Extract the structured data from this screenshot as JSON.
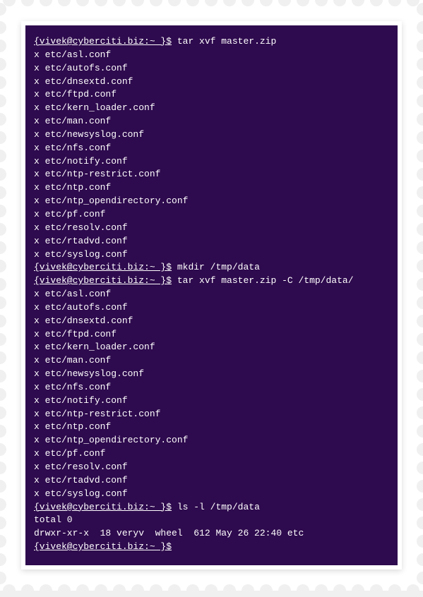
{
  "terminal": {
    "bg_color": "#2e0a4e",
    "fg_color": "#ffffff",
    "prompt_user": "{vivek@cyberciti.biz",
    "prompt_path": ":~ }$",
    "commands": [
      {
        "prompt": "{vivek@cyberciti.biz",
        "path": ":~ }$",
        "cmd": "tar xvf master.zip"
      },
      {
        "prompt": "{vivek@cyberciti.biz",
        "path": ":~ }$",
        "cmd": "mkdir /tmp/data"
      },
      {
        "prompt": "{vivek@cyberciti.biz",
        "path": ":~ }$",
        "cmd": "tar xvf master.zip -C /tmp/data/"
      },
      {
        "prompt": "{vivek@cyberciti.biz",
        "path": ":~ }$",
        "cmd": "ls -l /tmp/data"
      },
      {
        "prompt": "{vivek@cyberciti.biz",
        "path": ":~ }$",
        "cmd": ""
      }
    ],
    "extract_output_1": [
      "x etc/asl.conf",
      "x etc/autofs.conf",
      "x etc/dnsextd.conf",
      "x etc/ftpd.conf",
      "x etc/kern_loader.conf",
      "x etc/man.conf",
      "x etc/newsyslog.conf",
      "x etc/nfs.conf",
      "x etc/notify.conf",
      "x etc/ntp-restrict.conf",
      "x etc/ntp.conf",
      "x etc/ntp_opendirectory.conf",
      "x etc/pf.conf",
      "x etc/resolv.conf",
      "x etc/rtadvd.conf",
      "x etc/syslog.conf"
    ],
    "extract_output_2": [
      "x etc/asl.conf",
      "x etc/autofs.conf",
      "x etc/dnsextd.conf",
      "x etc/ftpd.conf",
      "x etc/kern_loader.conf",
      "x etc/man.conf",
      "x etc/newsyslog.conf",
      "x etc/nfs.conf",
      "x etc/notify.conf",
      "x etc/ntp-restrict.conf",
      "x etc/ntp.conf",
      "x etc/ntp_opendirectory.conf",
      "x etc/pf.conf",
      "x etc/resolv.conf",
      "x etc/rtadvd.conf",
      "x etc/syslog.conf"
    ],
    "ls_output": [
      "total 0",
      "drwxr-xr-x  18 veryv  wheel  612 May 26 22:40 etc"
    ]
  }
}
